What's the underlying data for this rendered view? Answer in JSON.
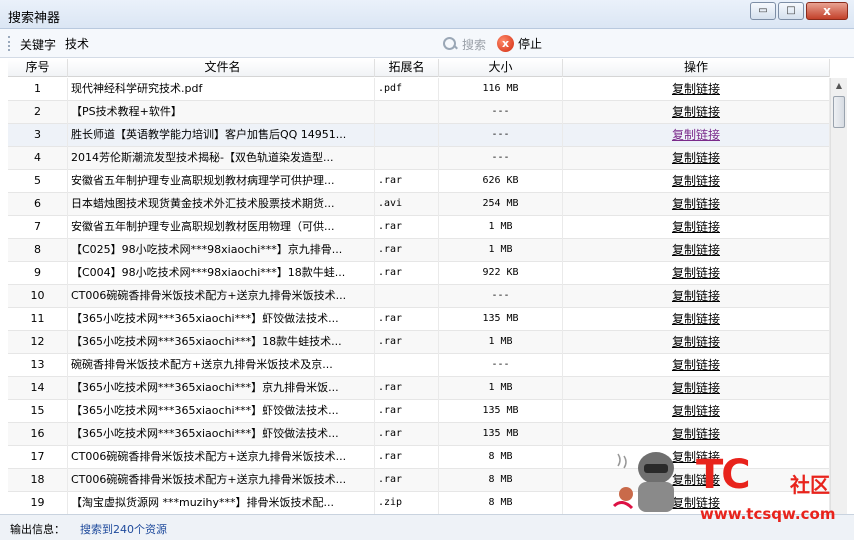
{
  "window": {
    "title": "搜索神器",
    "buttons": {
      "minimize": "▭",
      "maximize": "□",
      "close": "x"
    }
  },
  "toolbar": {
    "keyword_label": "关键字",
    "keyword_value": "技术",
    "search_label": "搜索",
    "stop_label": "停止",
    "stop_icon": "x"
  },
  "table": {
    "headers": [
      "序号",
      "文件名",
      "拓展名",
      "大小",
      "操作"
    ],
    "rows": [
      {
        "no": "1",
        "name": "现代神经科学研究技术.pdf",
        "ext": ".pdf",
        "size": "116 MB",
        "action": "复制链接"
      },
      {
        "no": "2",
        "name": "【PS技术教程+软件】",
        "ext": "",
        "size": "---",
        "action": "复制链接"
      },
      {
        "no": "3",
        "name": "胜长师道【英语教学能力培训】客户加售后QQ 14951...",
        "ext": "",
        "size": "---",
        "action": "复制链接"
      },
      {
        "no": "4",
        "name": "2014芳伦斯潮流发型技术揭秘-【双色轨道染发造型...",
        "ext": "",
        "size": "---",
        "action": "复制链接"
      },
      {
        "no": "5",
        "name": "安徽省五年制护理专业高职规划教材病理学可供护理...",
        "ext": ".rar",
        "size": "626 KB",
        "action": "复制链接"
      },
      {
        "no": "6",
        "name": "日本蜡烛图技术现货黄金技术外汇技术股票技术期货...",
        "ext": ".avi",
        "size": "254 MB",
        "action": "复制链接"
      },
      {
        "no": "7",
        "name": "安徽省五年制护理专业高职规划教材医用物理（可供...",
        "ext": ".rar",
        "size": "1 MB",
        "action": "复制链接"
      },
      {
        "no": "8",
        "name": "【C025】98小吃技术网***98xiaochi***】京九排骨...",
        "ext": ".rar",
        "size": "1 MB",
        "action": "复制链接"
      },
      {
        "no": "9",
        "name": "【C004】98小吃技术网***98xiaochi***】18款牛蛙...",
        "ext": ".rar",
        "size": "922 KB",
        "action": "复制链接"
      },
      {
        "no": "10",
        "name": "CT006碗碗香排骨米饭技术配方+送京九排骨米饭技术...",
        "ext": "",
        "size": "---",
        "action": "复制链接"
      },
      {
        "no": "11",
        "name": "【365小吃技术网***365xiaochi***】虾饺做法技术...",
        "ext": ".rar",
        "size": "135 MB",
        "action": "复制链接"
      },
      {
        "no": "12",
        "name": "【365小吃技术网***365xiaochi***】18款牛蛙技术...",
        "ext": ".rar",
        "size": "1 MB",
        "action": "复制链接"
      },
      {
        "no": "13",
        "name": "碗碗香排骨米饭技术配方+送京九排骨米饭技术及京...",
        "ext": "",
        "size": "---",
        "action": "复制链接"
      },
      {
        "no": "14",
        "name": "【365小吃技术网***365xiaochi***】京九排骨米饭...",
        "ext": ".rar",
        "size": "1 MB",
        "action": "复制链接"
      },
      {
        "no": "15",
        "name": "【365小吃技术网***365xiaochi***】虾饺做法技术...",
        "ext": ".rar",
        "size": "135 MB",
        "action": "复制链接"
      },
      {
        "no": "16",
        "name": "【365小吃技术网***365xiaochi***】虾饺做法技术...",
        "ext": ".rar",
        "size": "135 MB",
        "action": "复制链接"
      },
      {
        "no": "17",
        "name": "CT006碗碗香排骨米饭技术配方+送京九排骨米饭技术...",
        "ext": ".rar",
        "size": "8 MB",
        "action": "复制链接"
      },
      {
        "no": "18",
        "name": "CT006碗碗香排骨米饭技术配方+送京九排骨米饭技术...",
        "ext": ".rar",
        "size": "8 MB",
        "action": "复制链接"
      },
      {
        "no": "19",
        "name": "【淘宝虚拟货源网 ***muzihy***】排骨米饭技术配...",
        "ext": ".zip",
        "size": "8 MB",
        "action": "复制链接"
      }
    ]
  },
  "status": {
    "label": "输出信息：",
    "value": "搜索到240个资源"
  },
  "watermark": {
    "brand": "TC",
    "community": "社区",
    "url": "www.tcsqw.com"
  },
  "colors": {
    "titlebar": "#dbe6f4",
    "status_text": "#1e4a9c",
    "visited_link": "#7a2a8a",
    "watermark_red": "#e8231c"
  }
}
